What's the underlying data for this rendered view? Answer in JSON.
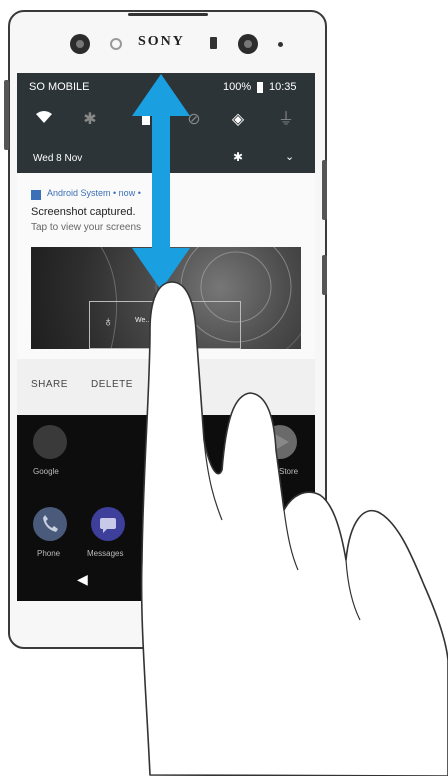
{
  "phone": {
    "brand": "SONY"
  },
  "status_bar": {
    "carrier": "SO MOBILE",
    "battery": "100%",
    "time": "10:35"
  },
  "quick_settings": {
    "date": "Wed 8 Nov",
    "icons": [
      "wifi-icon",
      "bluetooth-icon",
      "flashlight-icon",
      "dnd-icon",
      "auto-rotate-icon",
      "mobile-data-icon"
    ]
  },
  "notification": {
    "app": "Android System • now •",
    "title": "Screenshot captured.",
    "text": "Tap to view your screens",
    "preview_text": "We...   ...ona"
  },
  "actions": {
    "share": "SHARE",
    "delete": "DELETE"
  },
  "home": {
    "apps": [
      {
        "label": "Google",
        "icon": "google-folder-icon"
      },
      {
        "label": "Store",
        "icon": "play-store-icon"
      },
      {
        "label": "Phone",
        "icon": "phone-icon"
      },
      {
        "label": "Messages",
        "icon": "messages-icon"
      }
    ]
  },
  "colors": {
    "arrow": "#1a9fe0",
    "shade": "#2c3438",
    "accent": "#3b6fb6"
  }
}
